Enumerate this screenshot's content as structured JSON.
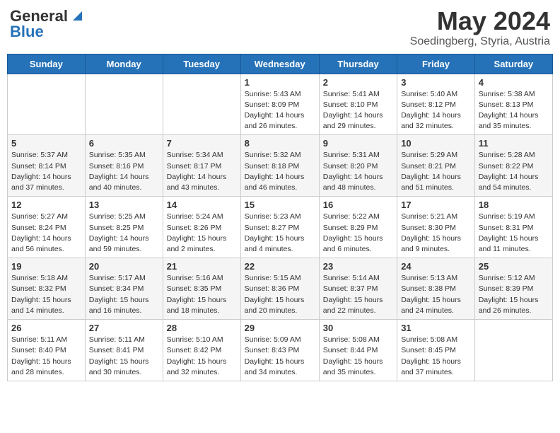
{
  "header": {
    "logo_general": "General",
    "logo_blue": "Blue",
    "month_title": "May 2024",
    "location": "Soedingberg, Styria, Austria"
  },
  "weekdays": [
    "Sunday",
    "Monday",
    "Tuesday",
    "Wednesday",
    "Thursday",
    "Friday",
    "Saturday"
  ],
  "weeks": [
    [
      {
        "day": "",
        "content": ""
      },
      {
        "day": "",
        "content": ""
      },
      {
        "day": "",
        "content": ""
      },
      {
        "day": "1",
        "content": "Sunrise: 5:43 AM\nSunset: 8:09 PM\nDaylight: 14 hours\nand 26 minutes."
      },
      {
        "day": "2",
        "content": "Sunrise: 5:41 AM\nSunset: 8:10 PM\nDaylight: 14 hours\nand 29 minutes."
      },
      {
        "day": "3",
        "content": "Sunrise: 5:40 AM\nSunset: 8:12 PM\nDaylight: 14 hours\nand 32 minutes."
      },
      {
        "day": "4",
        "content": "Sunrise: 5:38 AM\nSunset: 8:13 PM\nDaylight: 14 hours\nand 35 minutes."
      }
    ],
    [
      {
        "day": "5",
        "content": "Sunrise: 5:37 AM\nSunset: 8:14 PM\nDaylight: 14 hours\nand 37 minutes."
      },
      {
        "day": "6",
        "content": "Sunrise: 5:35 AM\nSunset: 8:16 PM\nDaylight: 14 hours\nand 40 minutes."
      },
      {
        "day": "7",
        "content": "Sunrise: 5:34 AM\nSunset: 8:17 PM\nDaylight: 14 hours\nand 43 minutes."
      },
      {
        "day": "8",
        "content": "Sunrise: 5:32 AM\nSunset: 8:18 PM\nDaylight: 14 hours\nand 46 minutes."
      },
      {
        "day": "9",
        "content": "Sunrise: 5:31 AM\nSunset: 8:20 PM\nDaylight: 14 hours\nand 48 minutes."
      },
      {
        "day": "10",
        "content": "Sunrise: 5:29 AM\nSunset: 8:21 PM\nDaylight: 14 hours\nand 51 minutes."
      },
      {
        "day": "11",
        "content": "Sunrise: 5:28 AM\nSunset: 8:22 PM\nDaylight: 14 hours\nand 54 minutes."
      }
    ],
    [
      {
        "day": "12",
        "content": "Sunrise: 5:27 AM\nSunset: 8:24 PM\nDaylight: 14 hours\nand 56 minutes."
      },
      {
        "day": "13",
        "content": "Sunrise: 5:25 AM\nSunset: 8:25 PM\nDaylight: 14 hours\nand 59 minutes."
      },
      {
        "day": "14",
        "content": "Sunrise: 5:24 AM\nSunset: 8:26 PM\nDaylight: 15 hours\nand 2 minutes."
      },
      {
        "day": "15",
        "content": "Sunrise: 5:23 AM\nSunset: 8:27 PM\nDaylight: 15 hours\nand 4 minutes."
      },
      {
        "day": "16",
        "content": "Sunrise: 5:22 AM\nSunset: 8:29 PM\nDaylight: 15 hours\nand 6 minutes."
      },
      {
        "day": "17",
        "content": "Sunrise: 5:21 AM\nSunset: 8:30 PM\nDaylight: 15 hours\nand 9 minutes."
      },
      {
        "day": "18",
        "content": "Sunrise: 5:19 AM\nSunset: 8:31 PM\nDaylight: 15 hours\nand 11 minutes."
      }
    ],
    [
      {
        "day": "19",
        "content": "Sunrise: 5:18 AM\nSunset: 8:32 PM\nDaylight: 15 hours\nand 14 minutes."
      },
      {
        "day": "20",
        "content": "Sunrise: 5:17 AM\nSunset: 8:34 PM\nDaylight: 15 hours\nand 16 minutes."
      },
      {
        "day": "21",
        "content": "Sunrise: 5:16 AM\nSunset: 8:35 PM\nDaylight: 15 hours\nand 18 minutes."
      },
      {
        "day": "22",
        "content": "Sunrise: 5:15 AM\nSunset: 8:36 PM\nDaylight: 15 hours\nand 20 minutes."
      },
      {
        "day": "23",
        "content": "Sunrise: 5:14 AM\nSunset: 8:37 PM\nDaylight: 15 hours\nand 22 minutes."
      },
      {
        "day": "24",
        "content": "Sunrise: 5:13 AM\nSunset: 8:38 PM\nDaylight: 15 hours\nand 24 minutes."
      },
      {
        "day": "25",
        "content": "Sunrise: 5:12 AM\nSunset: 8:39 PM\nDaylight: 15 hours\nand 26 minutes."
      }
    ],
    [
      {
        "day": "26",
        "content": "Sunrise: 5:11 AM\nSunset: 8:40 PM\nDaylight: 15 hours\nand 28 minutes."
      },
      {
        "day": "27",
        "content": "Sunrise: 5:11 AM\nSunset: 8:41 PM\nDaylight: 15 hours\nand 30 minutes."
      },
      {
        "day": "28",
        "content": "Sunrise: 5:10 AM\nSunset: 8:42 PM\nDaylight: 15 hours\nand 32 minutes."
      },
      {
        "day": "29",
        "content": "Sunrise: 5:09 AM\nSunset: 8:43 PM\nDaylight: 15 hours\nand 34 minutes."
      },
      {
        "day": "30",
        "content": "Sunrise: 5:08 AM\nSunset: 8:44 PM\nDaylight: 15 hours\nand 35 minutes."
      },
      {
        "day": "31",
        "content": "Sunrise: 5:08 AM\nSunset: 8:45 PM\nDaylight: 15 hours\nand 37 minutes."
      },
      {
        "day": "",
        "content": ""
      }
    ]
  ]
}
